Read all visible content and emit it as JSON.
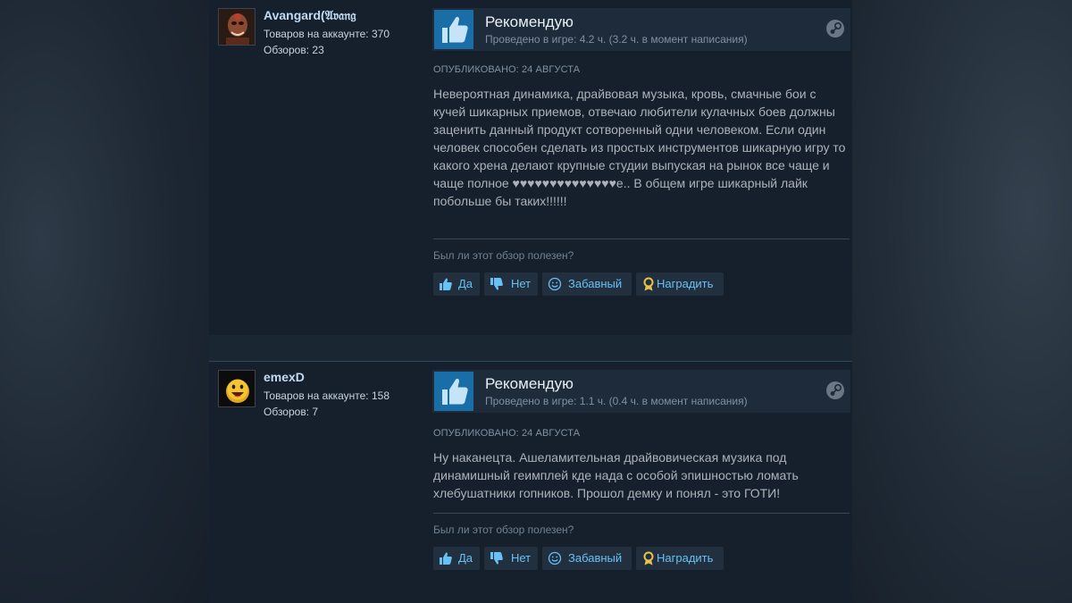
{
  "reviews": [
    {
      "author": "Avangard(𝔄𝔳𝔞𝔫𝔤",
      "products_label": "Товаров на аккаунте:",
      "products_count": "370",
      "reviews_label": "Обзоров:",
      "reviews_count": "23",
      "verdict": "Рекомендую",
      "hours": "Проведено в игре: 4.2 ч. (3.2 ч. в момент написания)",
      "posted": "Опубликовано: 24 августа",
      "text": "Невероятная динамика, драйвовая музыка, кровь, смачные бои с кучей шикарных приемов, отвечаю любители кулачных боев должны заценить данный продукт сотворенный одни человеком. Если один человек способен сделать из простых инструментов шикарную игру то какого хрена делают крупные студии выпуская на рынок все чаще и чаще полное ♥♥♥♥♥♥♥♥♥♥♥♥♥♥е.. В общем игре шикарный лайк побольше бы таких!!!!!!",
      "helpful_question": "Был ли этот обзор полезен?",
      "btn_yes": "Да",
      "btn_no": "Нет",
      "btn_funny": "Забавный",
      "btn_award": "Наградить"
    },
    {
      "author": "emexD",
      "products_label": "Товаров на аккаунте:",
      "products_count": "158",
      "reviews_label": "Обзоров:",
      "reviews_count": "7",
      "verdict": "Рекомендую",
      "hours": "Проведено в игре: 1.1 ч. (0.4 ч. в момент написания)",
      "posted": "Опубликовано: 24 августа",
      "text": "Ну наканецта. Ашеламительная драйвовическая музика под динамишный геимплей кде нада с особой эпишностью ломать хлебушатники гопников. Прошол демку и понял - это ГОТИ!",
      "helpful_question": "Был ли этот обзор полезен?",
      "btn_yes": "Да",
      "btn_no": "Нет",
      "btn_funny": "Забавный",
      "btn_award": "Наградить"
    }
  ],
  "colors": {
    "accent_link": "#67c1f5",
    "thumb_bg": "#1a6ea8",
    "award_gold": "#e8c34a"
  }
}
